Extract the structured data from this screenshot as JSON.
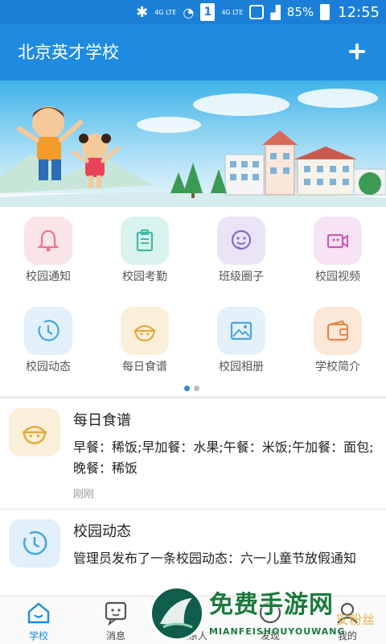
{
  "status_bar": {
    "bluetooth_icon": "bluetooth-icon",
    "network_small": "4G LTE",
    "sim_label": "1",
    "network_small_2": "4G LTE",
    "battery_percent": "85%",
    "time": "12:55"
  },
  "header": {
    "title": "北京英才学校",
    "add_icon": "plus-icon"
  },
  "colors": {
    "primary": "#1e8be0",
    "status_bar": "#1b7fd8",
    "notice": "#f9e4e7",
    "attendance": "#d9f3ef",
    "circle": "#ebe4f7",
    "video": "#f7e3f3",
    "news": "#e1f0fb",
    "recipe": "#fbefd9",
    "album": "#e3f1fb",
    "intro": "#fbe8d9"
  },
  "features": [
    {
      "label": "校园通知",
      "icon": "bell-icon"
    },
    {
      "label": "校园考勤",
      "icon": "clipboard-icon"
    },
    {
      "label": "班级圈子",
      "icon": "smiley-chat-icon"
    },
    {
      "label": "校园视频",
      "icon": "video-camera-icon"
    },
    {
      "label": "校园动态",
      "icon": "clock-icon"
    },
    {
      "label": "每日食谱",
      "icon": "food-bowl-icon"
    },
    {
      "label": "校园相册",
      "icon": "photo-icon"
    },
    {
      "label": "学校简介",
      "icon": "wallet-icon"
    }
  ],
  "pager": {
    "total": 2,
    "active": 1
  },
  "feed": [
    {
      "title": "每日食谱",
      "body": "早餐：稀饭;早加餐：水果;午餐：米饭;午加餐：面包;晚餐：稀饭",
      "time": "刚刚",
      "icon": "food-bowl-icon"
    },
    {
      "title": "校园动态",
      "body": "管理员发布了一条校园动态：六一儿童节放假通知",
      "time": "",
      "icon": "clock-icon"
    }
  ],
  "tabs": [
    {
      "label": "学校",
      "icon": "home-icon",
      "active": true
    },
    {
      "label": "消息",
      "icon": "chat-icon",
      "active": false
    },
    {
      "label": "联系人",
      "icon": "contacts-icon",
      "active": false
    },
    {
      "label": "发现",
      "icon": "discover-icon",
      "active": false
    },
    {
      "label": "我的",
      "icon": "profile-icon",
      "active": false
    }
  ],
  "watermark": {
    "big": "免费手游网",
    "small": "MIANFEISHOUYOUWANG",
    "side": "安粉丝"
  }
}
